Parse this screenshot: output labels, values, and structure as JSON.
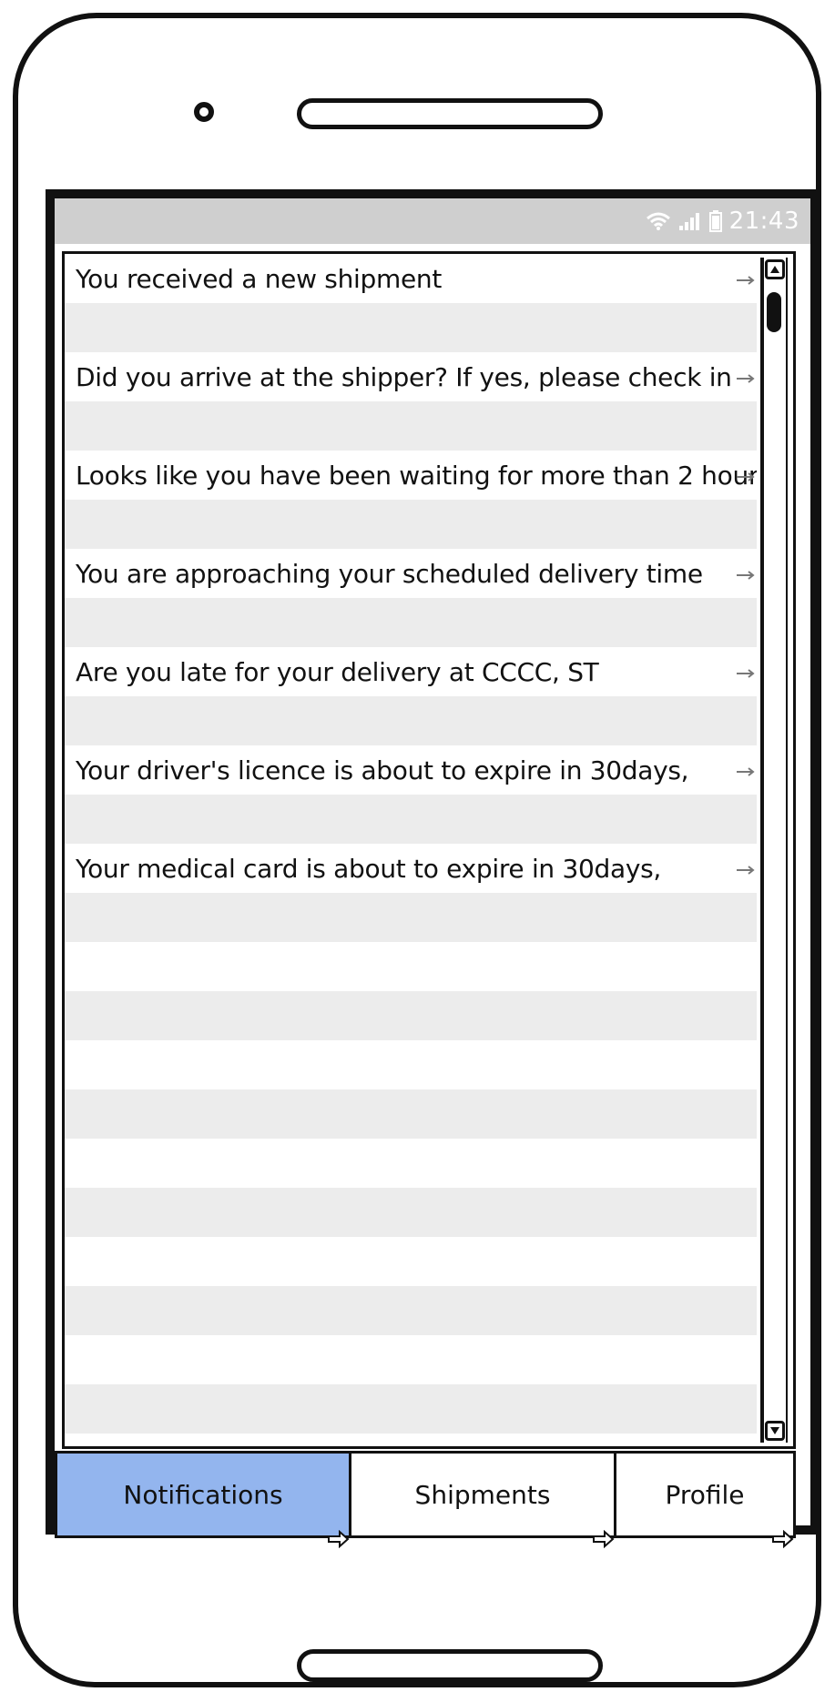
{
  "status_bar": {
    "time": "21:43",
    "icons": [
      "wifi-icon",
      "signal-icon",
      "battery-icon"
    ]
  },
  "notifications": [
    {
      "text": "You received a new shipment"
    },
    {
      "text": "Did you arrive at the shipper? If yes, please check in"
    },
    {
      "text": "Looks like you have been waiting for more than 2 hours"
    },
    {
      "text": "You are approaching your scheduled delivery time"
    },
    {
      "text": "Are you late for your delivery at CCCC, ST"
    },
    {
      "text": "Your driver's licence is about to expire in 30days,"
    },
    {
      "text": "Your medical card is about to expire in 30days,"
    }
  ],
  "empty_rows": 11,
  "tabs": [
    {
      "label": "Notifications",
      "active": true
    },
    {
      "label": "Shipments",
      "active": false
    },
    {
      "label": "Profile",
      "active": false
    }
  ],
  "colors": {
    "active_tab": "#93b5ee",
    "status_bar": "#cfcfcf",
    "alt_row": "#ececec"
  }
}
